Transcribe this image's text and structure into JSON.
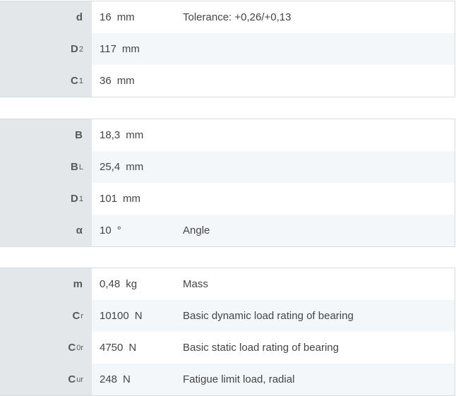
{
  "groups": [
    {
      "rows": [
        {
          "symbol": "d",
          "sub": "",
          "value": "16",
          "unit": "mm",
          "description": "Tolerance: +0,26/+0,13"
        },
        {
          "symbol": "D",
          "sub": "2",
          "value": "117",
          "unit": "mm",
          "description": ""
        },
        {
          "symbol": "C",
          "sub": "1",
          "value": "36",
          "unit": "mm",
          "description": ""
        }
      ]
    },
    {
      "rows": [
        {
          "symbol": "B",
          "sub": "",
          "value": "18,3",
          "unit": "mm",
          "description": ""
        },
        {
          "symbol": "B",
          "sub": "L",
          "value": "25,4",
          "unit": "mm",
          "description": ""
        },
        {
          "symbol": "D",
          "sub": "1",
          "value": "101",
          "unit": "mm",
          "description": ""
        },
        {
          "symbol": "α",
          "sub": "",
          "value": "10",
          "unit": "°",
          "description": "Angle"
        }
      ]
    },
    {
      "rows": [
        {
          "symbol": "m",
          "sub": "",
          "value": "0,48",
          "unit": "kg",
          "description": "Mass"
        },
        {
          "symbol": "C",
          "sub": "r",
          "value": "10100",
          "unit": "N",
          "description": "Basic dynamic load rating of bearing"
        },
        {
          "symbol": "C",
          "sub": "0r",
          "value": "4750",
          "unit": "N",
          "description": "Basic static load rating of bearing"
        },
        {
          "symbol": "C",
          "sub": "ur",
          "value": "248",
          "unit": "N",
          "description": "Fatigue limit load, radial"
        }
      ]
    }
  ]
}
